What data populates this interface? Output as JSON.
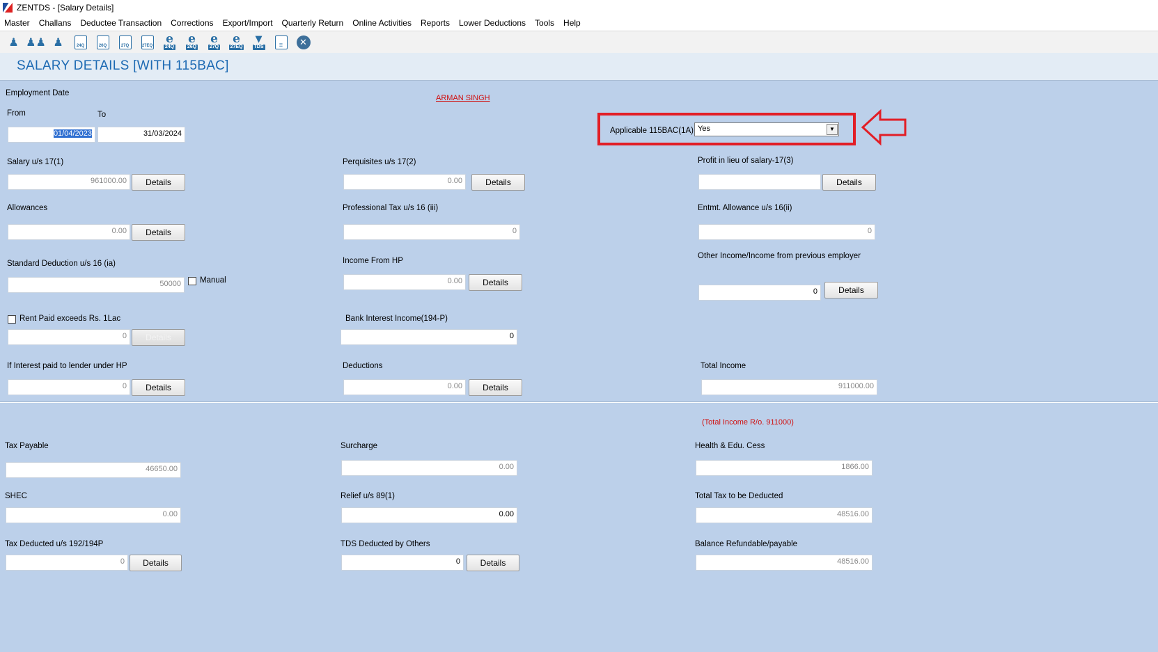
{
  "window": {
    "title": "ZENTDS - [Salary Details]"
  },
  "menu": [
    "Master",
    "Challans",
    "Deductee Transaction",
    "Corrections",
    "Export/Import",
    "Quarterly Return",
    "Online Activities",
    "Reports",
    "Lower Deductions",
    "Tools",
    "Help"
  ],
  "toolbar": {
    "doc_labels": [
      "24Q",
      "26Q",
      "27Q",
      "27EQ"
    ],
    "e_labels": [
      "24Q",
      "26Q",
      "27Q",
      "27EQ"
    ],
    "tds_label": "TDS"
  },
  "page": {
    "title": "SALARY DETAILS  [WITH 115BAC]"
  },
  "employee_name": "ARMAN SINGH",
  "employment": {
    "heading": "Employment Date",
    "from_label": "From",
    "to_label": "To",
    "from_value": "01/04/2023",
    "to_value": "31/03/2024"
  },
  "applicable_115bac": {
    "label": "Applicable 115BAC(1A)",
    "value": "Yes"
  },
  "details_label": "Details",
  "fields": {
    "salary_17_1": {
      "label": "Salary u/s 17(1)",
      "value": "961000.00"
    },
    "perquisites_17_2": {
      "label": "Perquisites u/s 17(2)",
      "value": "0.00"
    },
    "profit_17_3": {
      "label": "Profit in lieu of salary-17(3)",
      "value": ""
    },
    "allowances": {
      "label": "Allowances",
      "value": "0.00"
    },
    "professional_tax": {
      "label": "Professional Tax u/s 16 (iii)",
      "value": "0"
    },
    "entmt_allowance": {
      "label": "Entmt. Allowance u/s 16(ii)",
      "value": "0"
    },
    "standard_deduction": {
      "label": "Standard Deduction u/s 16 (ia)",
      "value": "50000",
      "manual_label": "Manual"
    },
    "income_hp": {
      "label": "Income From HP",
      "value": "0.00"
    },
    "other_income": {
      "label": "Other Income/Income from previous employer",
      "value": "0"
    },
    "rent_paid": {
      "label": "Rent Paid exceeds Rs. 1Lac",
      "value": "0"
    },
    "bank_interest": {
      "label": "Bank Interest Income(194-P)",
      "value": "0"
    },
    "interest_lender": {
      "label": "If Interest paid to lender under HP",
      "value": "0"
    },
    "deductions": {
      "label": "Deductions",
      "value": "0.00"
    },
    "total_income": {
      "label": "Total Income",
      "value": "911000.00"
    }
  },
  "total_income_ro": "(Total Income R/o. 911000)",
  "tax": {
    "tax_payable": {
      "label": "Tax Payable",
      "value": "46650.00"
    },
    "surcharge": {
      "label": "Surcharge",
      "value": "0.00"
    },
    "health_cess": {
      "label": "Health & Edu. Cess",
      "value": "1866.00"
    },
    "shec": {
      "label": "SHEC",
      "value": "0.00"
    },
    "relief_89": {
      "label": "Relief u/s 89(1)",
      "value": "0.00"
    },
    "total_tax": {
      "label": "Total Tax to be Deducted",
      "value": "48516.00"
    },
    "tax_deducted": {
      "label": "Tax Deducted u/s 192/194P",
      "value": "0"
    },
    "tds_others": {
      "label": "TDS Deducted by Others",
      "value": "0"
    },
    "balance": {
      "label": "Balance Refundable/payable",
      "value": "48516.00"
    }
  }
}
